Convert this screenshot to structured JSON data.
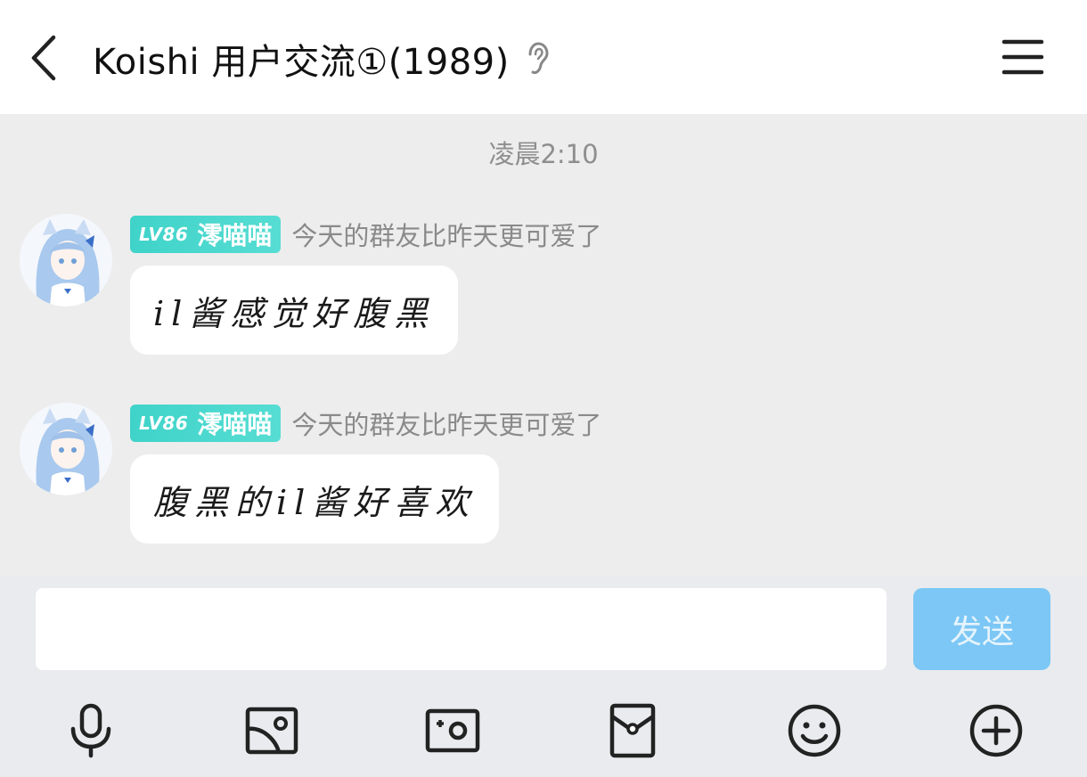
{
  "header": {
    "title": "Koishi 用户交流①(1989)",
    "back_icon": "back-chevron-icon",
    "ear_icon": "ear-icon",
    "menu_icon": "hamburger-menu-icon"
  },
  "chat": {
    "time_separator": "凌晨2:10",
    "messages": [
      {
        "level": "LV86",
        "sender": "澪喵喵",
        "title_tag": "今天的群友比昨天更可爱了",
        "text": "il酱感觉好腹黑"
      },
      {
        "level": "LV86",
        "sender": "澪喵喵",
        "title_tag": "今天的群友比昨天更可爱了",
        "text": "腹黑的il酱好喜欢"
      }
    ]
  },
  "composer": {
    "input_value": "",
    "send_label": "发送",
    "tools": [
      "microphone-icon",
      "image-icon",
      "camera-icon",
      "red-packet-icon",
      "emoji-icon",
      "plus-circle-icon"
    ]
  },
  "colors": {
    "badge": "#3fd3c9",
    "send_button": "#7cc7f5",
    "background": "#ededed",
    "bubble": "#ffffff"
  }
}
